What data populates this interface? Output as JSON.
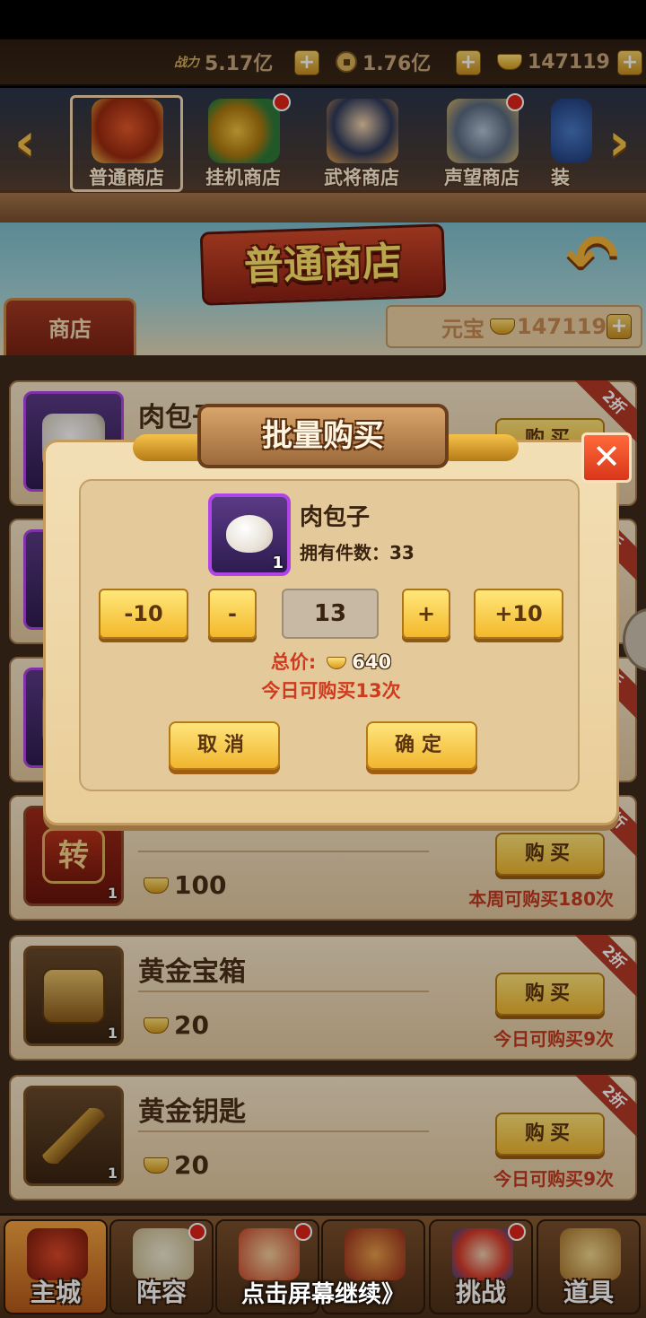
{
  "resources": {
    "power_label": "战力",
    "power_value": "5.17亿",
    "coins_value": "1.76亿",
    "ingots_value": "147119",
    "plus": "+"
  },
  "shop_tabs": [
    {
      "label": "普通商店",
      "icon": "treasure-chest-icon"
    },
    {
      "label": "挂机商店",
      "icon": "jade-coin-icon"
    },
    {
      "label": "武将商店",
      "icon": "general-icon"
    },
    {
      "label": "声望商店",
      "icon": "armor-icon"
    },
    {
      "label": "装",
      "icon": "equipment-icon"
    }
  ],
  "nav_arrows": {
    "left": "‹",
    "right": "›"
  },
  "banner": {
    "title": "普通商店",
    "tab_label": "商店",
    "currency_label": "元宝",
    "currency_value": "147119",
    "back_glyph": "↶"
  },
  "items": [
    {
      "name": "肉包子",
      "price": "",
      "buy": "购买",
      "limit": "",
      "discount": "2折",
      "count": "",
      "icon": "meat-bun-icon"
    },
    {
      "name": "",
      "price": "",
      "buy": "",
      "limit": "",
      "discount": "折",
      "count": "",
      "icon": "red-item-icon"
    },
    {
      "name": "",
      "price": "",
      "buy": "",
      "limit": "",
      "discount": "折",
      "count": "",
      "icon": "gold-item-icon"
    },
    {
      "name": "",
      "price": "100",
      "buy": "购买",
      "limit": "本周可购买180次",
      "discount": "3折",
      "count": "1",
      "icon": "transfer-token-icon",
      "token_glyph": "转"
    },
    {
      "name": "黄金宝箱",
      "price": "20",
      "buy": "购买",
      "limit": "今日可购买9次",
      "discount": "2折",
      "count": "1",
      "icon": "golden-chest-icon"
    },
    {
      "name": "黄金钥匙",
      "price": "20",
      "buy": "购买",
      "limit": "今日可购买9次",
      "discount": "2折",
      "count": "1",
      "icon": "golden-key-icon"
    }
  ],
  "dialog": {
    "title": "批量购买",
    "close": "✕",
    "item_name": "肉包子",
    "item_count": "1",
    "owned": "拥有件数：33",
    "minus10": "-10",
    "minus": "-",
    "quantity": "13",
    "plus": "+",
    "plus10": "+10",
    "total_label": "总价:",
    "total_value": "640",
    "daily_limit": "今日可购买13次",
    "cancel": "取消",
    "confirm": "确定"
  },
  "bottom_nav": [
    {
      "label": "主城",
      "icon": "palace-icon",
      "badge": false
    },
    {
      "label": "阵容",
      "icon": "formation-icon",
      "badge": true
    },
    {
      "label": "",
      "icon": "hero-icon",
      "badge": true
    },
    {
      "label": "",
      "icon": "bag-icon",
      "badge": false
    },
    {
      "label": "挑战",
      "icon": "challenge-icon",
      "badge": true
    },
    {
      "label": "道具",
      "icon": "items-icon",
      "badge": false
    }
  ],
  "continue_hint": "点击屏幕继续》",
  "colors": {
    "accent_gold": "#f0b62e",
    "warning_red": "#cf3a1e",
    "rare_purple": "#b044e8"
  }
}
